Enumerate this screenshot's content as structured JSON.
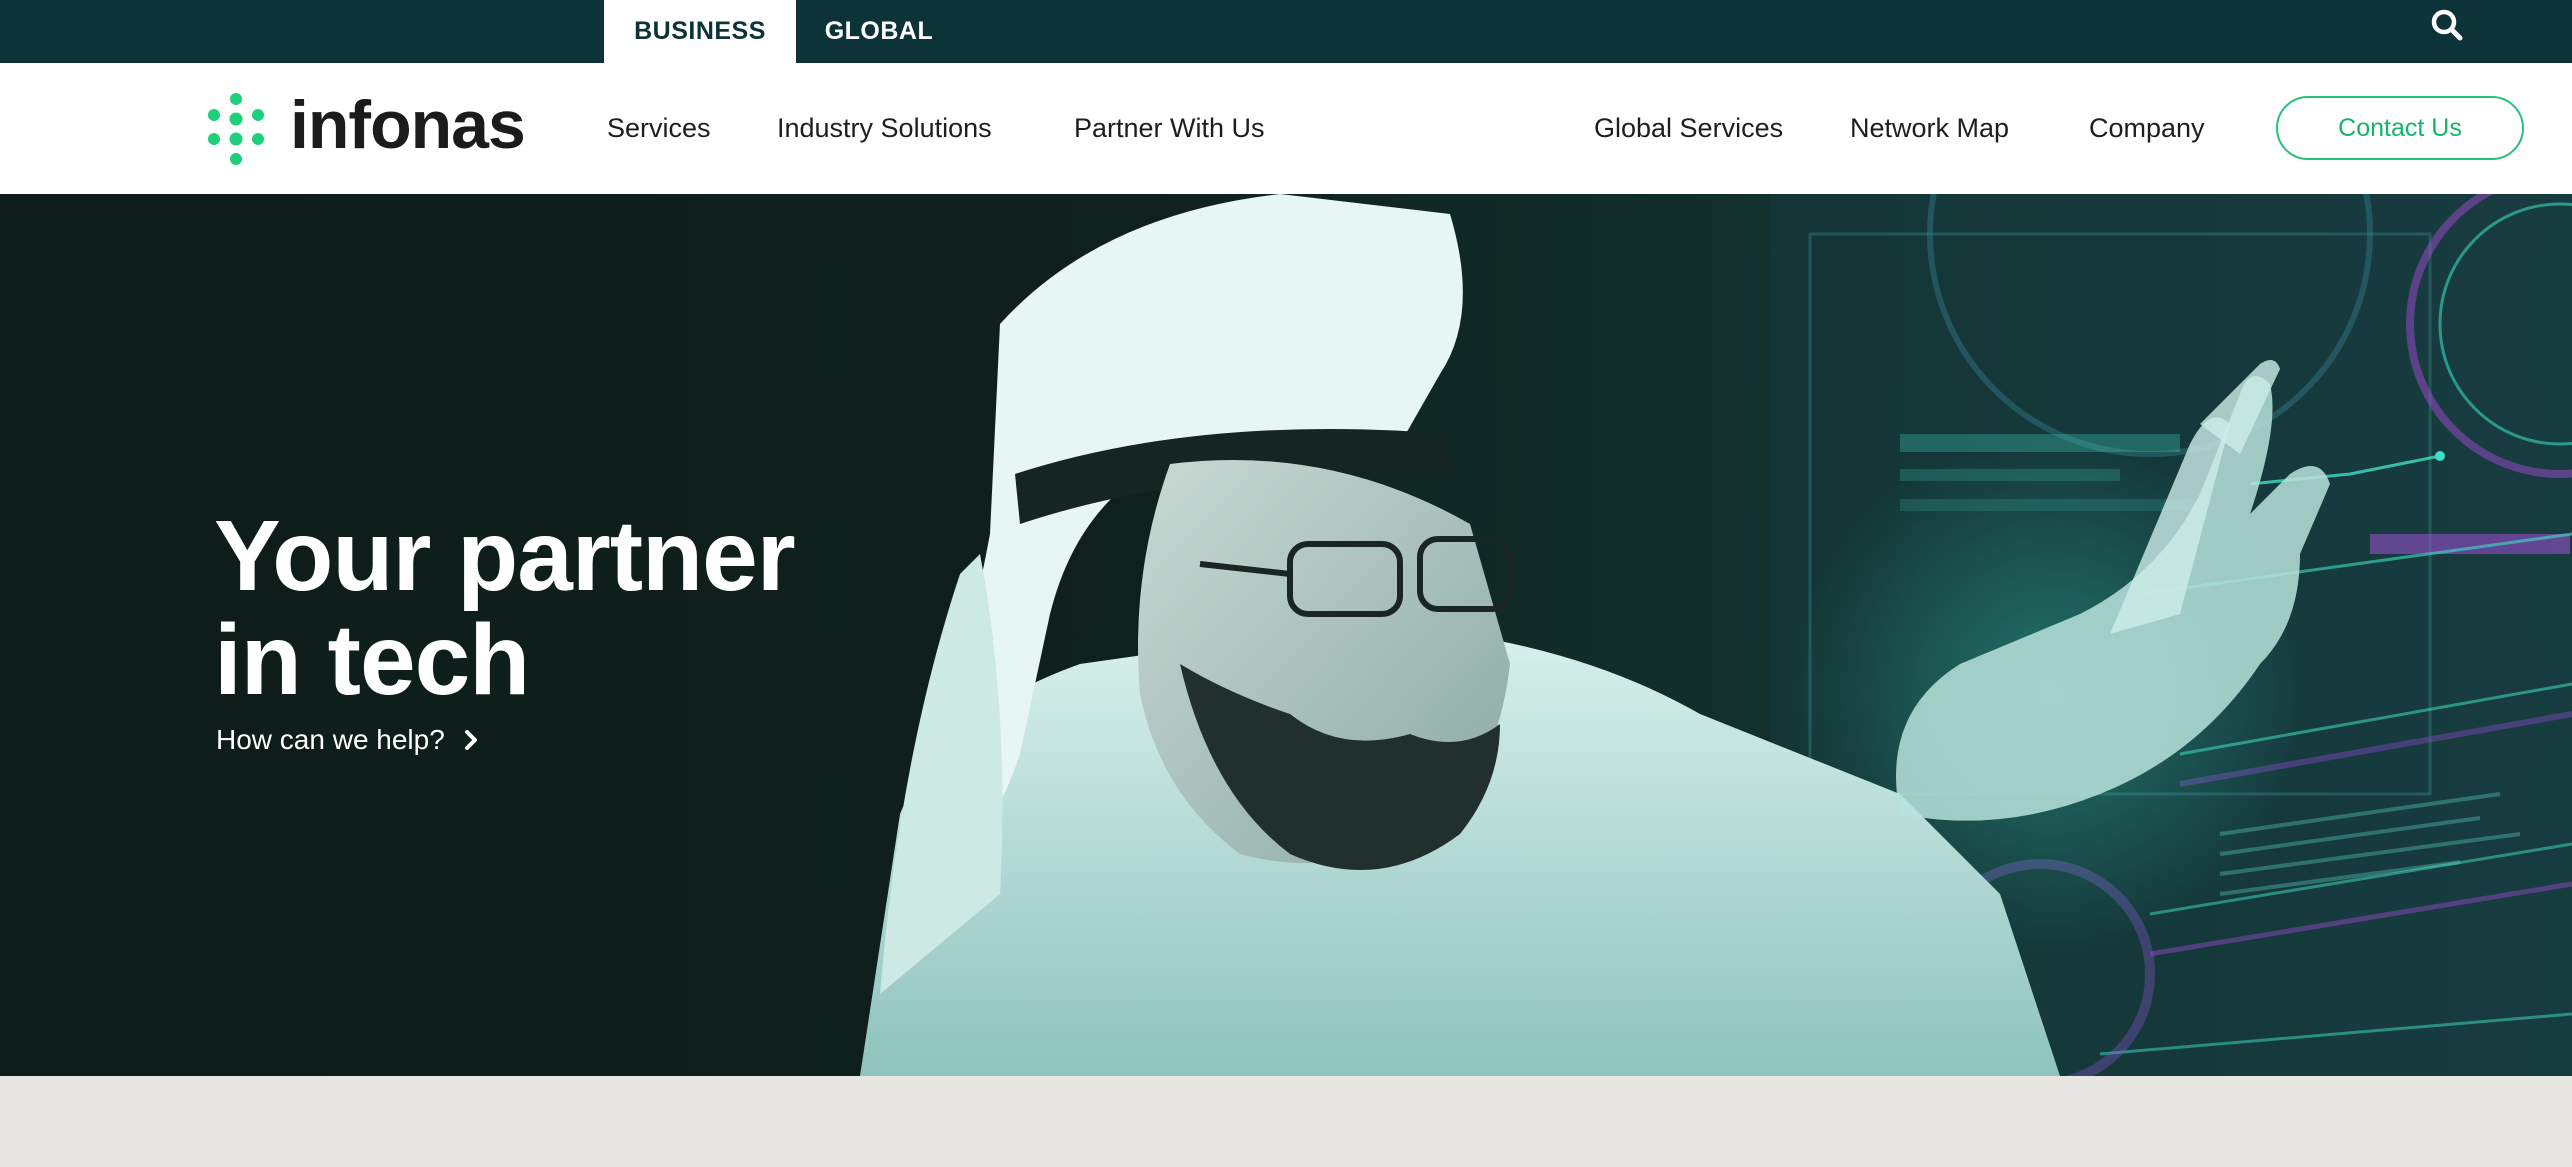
{
  "topbar": {
    "tabs": [
      {
        "label": "BUSINESS",
        "active": true
      },
      {
        "label": "GLOBAL",
        "active": false
      }
    ],
    "search_icon": "search-icon"
  },
  "brand": {
    "name": "infonas",
    "accent_color": "#1fd07a",
    "dark_color": "#0c3438"
  },
  "nav": {
    "left_items": [
      "Services",
      "Industry Solutions",
      "Partner With Us"
    ],
    "right_items": [
      "Global Services",
      "Network Map",
      "Company"
    ],
    "contact_label": "Contact Us"
  },
  "hero": {
    "title_line1": "Your partner",
    "title_line2": "in tech",
    "cta_label": "How can we help?",
    "cta_icon": "chevron-right-icon"
  }
}
